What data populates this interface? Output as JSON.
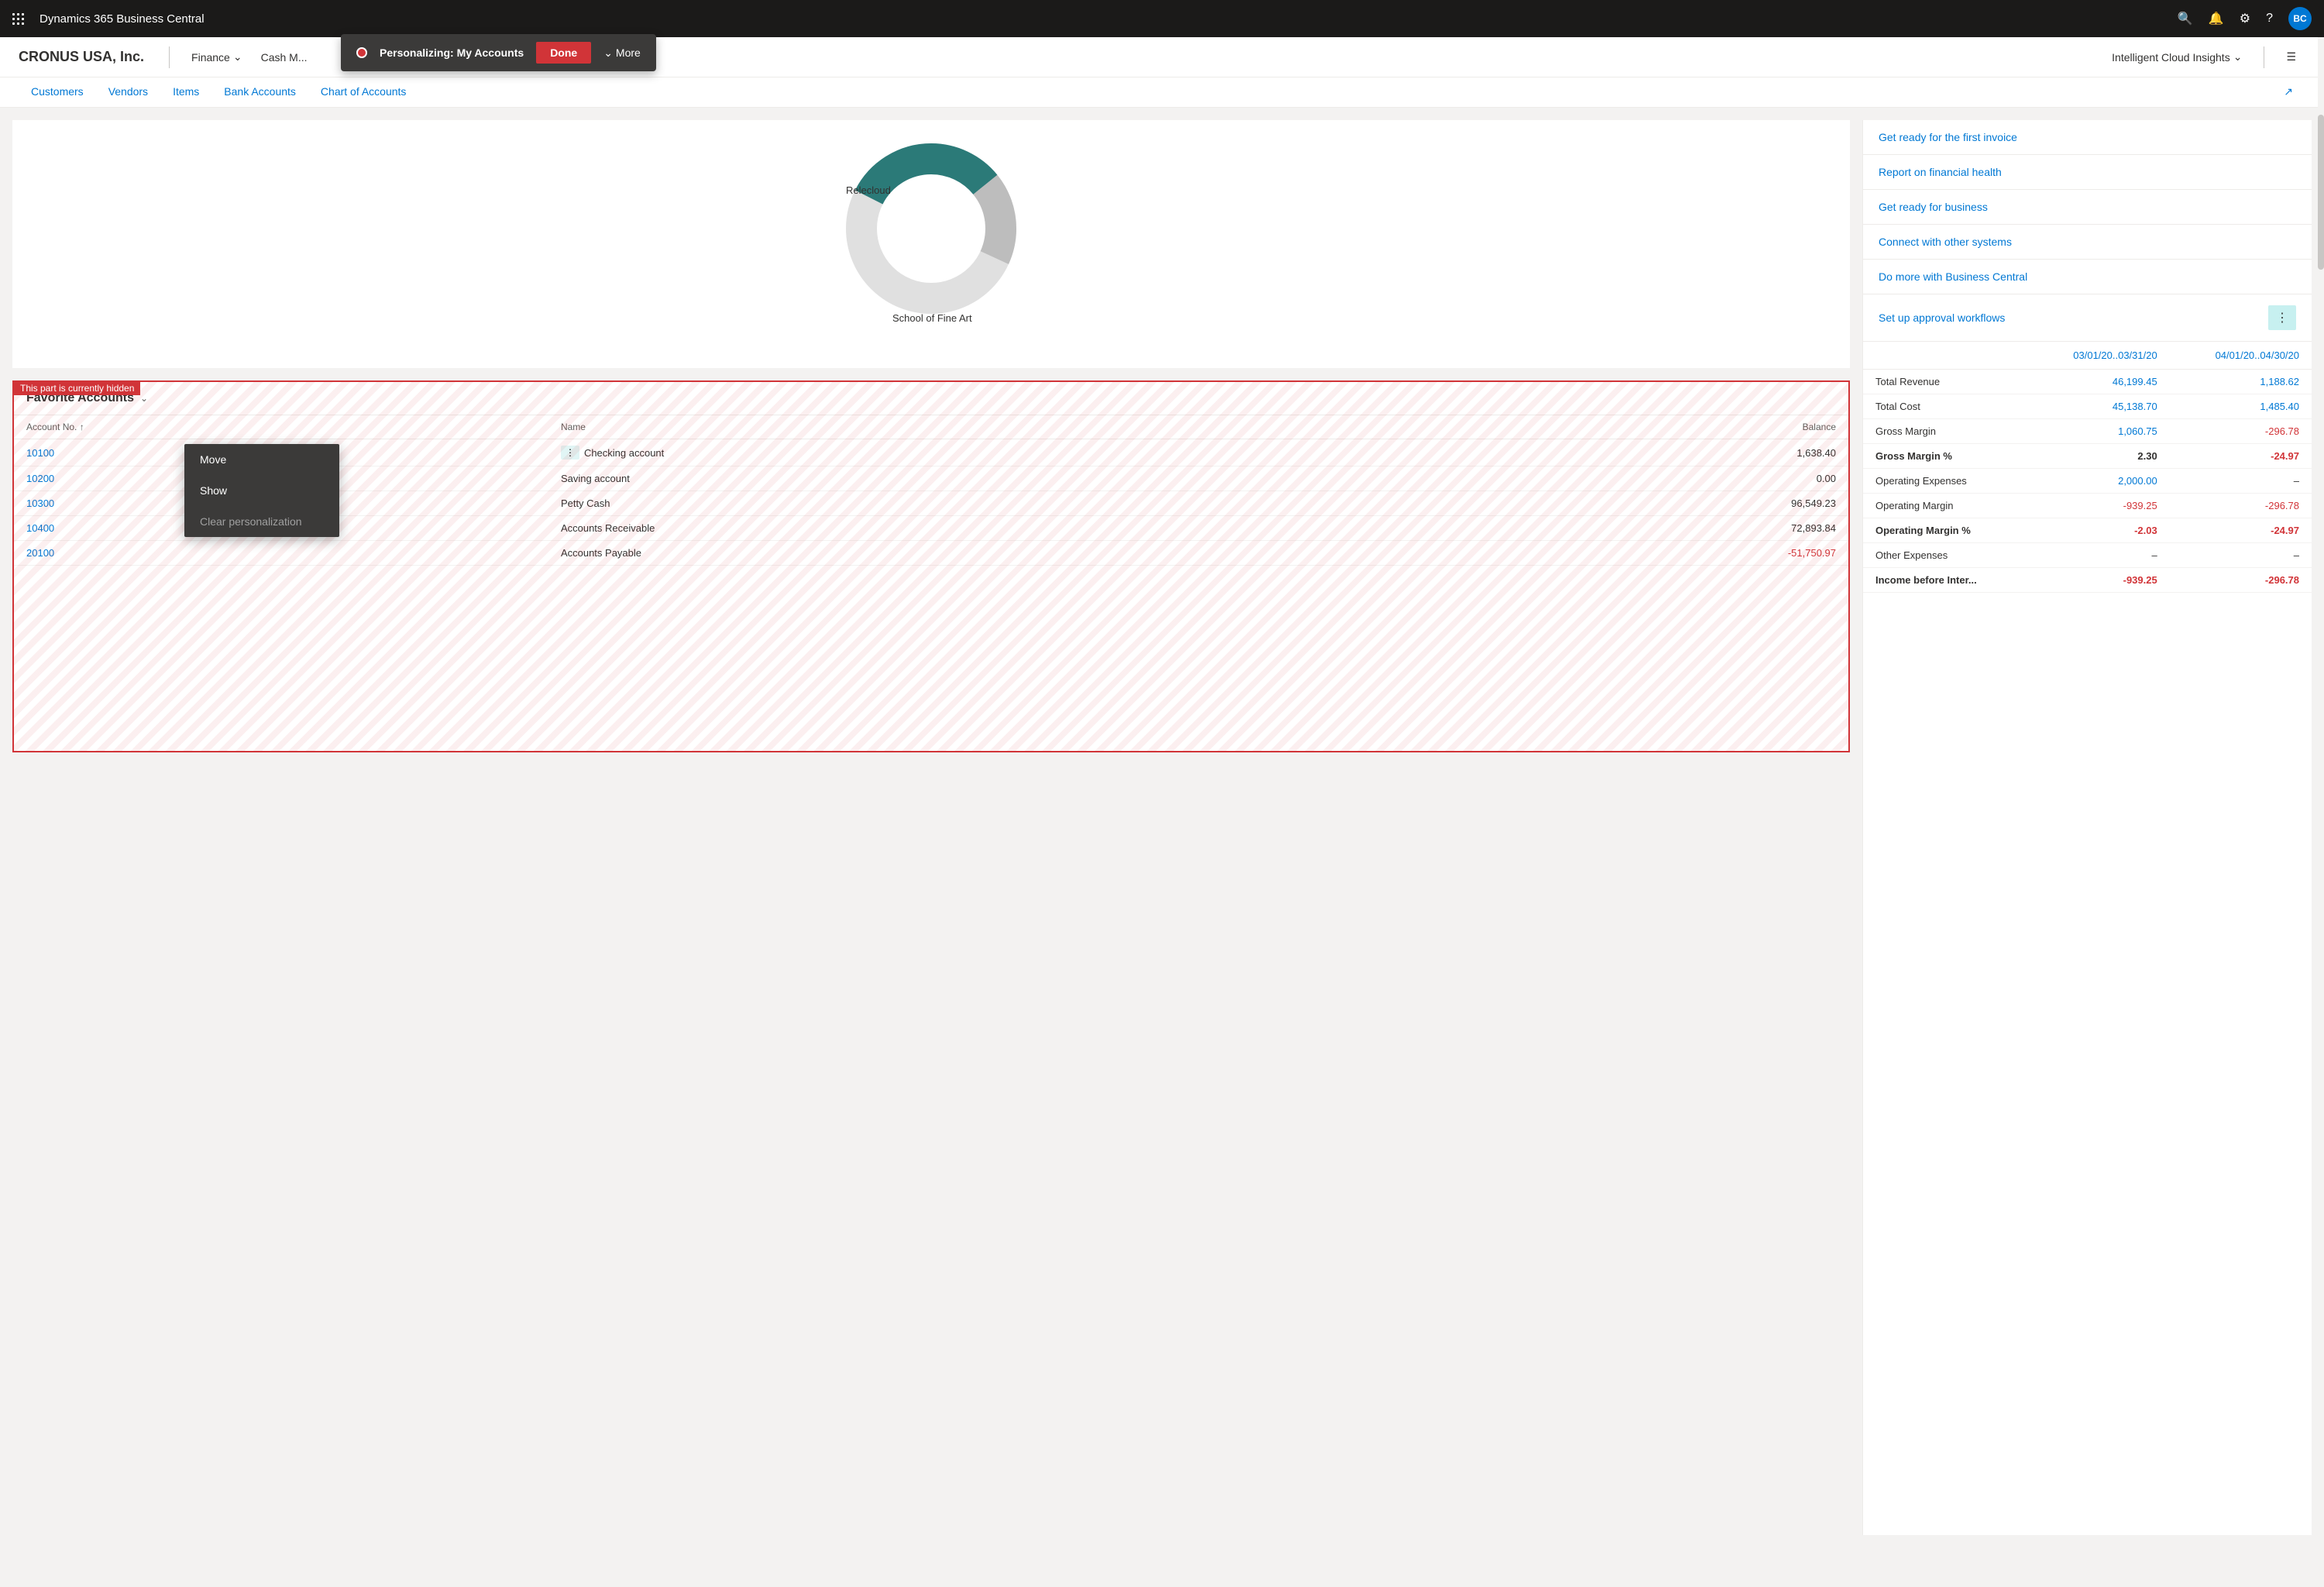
{
  "app": {
    "title": "Dynamics 365 Business Central",
    "avatar": "BC"
  },
  "personalizing": {
    "label": "Personalizing:",
    "context": "My Accounts",
    "done_label": "Done",
    "more_label": "More"
  },
  "nav": {
    "company": "CRONUS USA, Inc.",
    "items": [
      {
        "label": "Finance",
        "hasArrow": true
      },
      {
        "label": "Cash M...",
        "hasArrow": false
      }
    ]
  },
  "tabs": [
    {
      "label": "Customers"
    },
    {
      "label": "Vendors"
    },
    {
      "label": "Items"
    },
    {
      "label": "Bank Accounts"
    },
    {
      "label": "Chart of Accounts"
    }
  ],
  "intelligent_cloud": {
    "label": "Intelligent Cloud Insights",
    "hasArrow": true
  },
  "donut": {
    "label_relecloud": "Relecloud",
    "label_school": "School of Fine Art"
  },
  "getting_started": {
    "items": [
      {
        "label": "Get ready for the first invoice"
      },
      {
        "label": "Report on financial health"
      },
      {
        "label": "Get ready for business"
      },
      {
        "label": "Connect with other systems"
      },
      {
        "label": "Do more with Business Central"
      },
      {
        "label": "Set up approval workflows"
      }
    ]
  },
  "hidden_section": {
    "hidden_label": "This part is currently hidden",
    "title": "Favorite Accounts"
  },
  "accounts_table": {
    "headers": [
      "Account No. ↑",
      "Name",
      "Balance"
    ],
    "rows": [
      {
        "no": "10100",
        "name": "Checking account",
        "balance": "1,638.40",
        "negative": false
      },
      {
        "no": "10200",
        "name": "Saving account",
        "balance": "0.00",
        "negative": false
      },
      {
        "no": "10300",
        "name": "Petty Cash",
        "balance": "96,549.23",
        "negative": false
      },
      {
        "no": "10400",
        "name": "Accounts Receivable",
        "balance": "72,893.84",
        "negative": false
      },
      {
        "no": "20100",
        "name": "Accounts Payable",
        "balance": "-51,750.97",
        "negative": true
      }
    ]
  },
  "context_menu": {
    "items": [
      {
        "label": "Move"
      },
      {
        "label": "Show"
      },
      {
        "label": "Clear personalization"
      }
    ]
  },
  "fin_table": {
    "col1": "03/01/20..03/31/20",
    "col2": "04/01/20..04/30/20",
    "rows": [
      {
        "label": "Total Revenue",
        "val1": "46,199.45",
        "val2": "1,188.62",
        "bold": false,
        "neg1": false,
        "neg2": false
      },
      {
        "label": "Total Cost",
        "val1": "45,138.70",
        "val2": "1,485.40",
        "bold": false,
        "neg1": false,
        "neg2": false
      },
      {
        "label": "Gross Margin",
        "val1": "1,060.75",
        "val2": "-296.78",
        "bold": false,
        "neg1": false,
        "neg2": true
      },
      {
        "label": "Gross Margin %",
        "val1": "2.30",
        "val2": "-24.97",
        "bold": true,
        "neg1": false,
        "neg2": true
      },
      {
        "label": "Operating Expenses",
        "val1": "2,000.00",
        "val2": "–",
        "bold": false,
        "neg1": false,
        "neg2": false,
        "dash2": true
      },
      {
        "label": "Operating Margin",
        "val1": "-939.25",
        "val2": "-296.78",
        "bold": false,
        "neg1": true,
        "neg2": true
      },
      {
        "label": "Operating Margin %",
        "val1": "-2.03",
        "val2": "-24.97",
        "bold": true,
        "neg1": true,
        "neg2": true
      },
      {
        "label": "Other Expenses",
        "val1": "–",
        "val2": "–",
        "bold": false,
        "neg1": false,
        "neg2": false,
        "dash1": true,
        "dash2": true
      },
      {
        "label": "Income before Inter...",
        "val1": "-939.25",
        "val2": "-296.78",
        "bold": true,
        "neg1": true,
        "neg2": true
      }
    ]
  }
}
